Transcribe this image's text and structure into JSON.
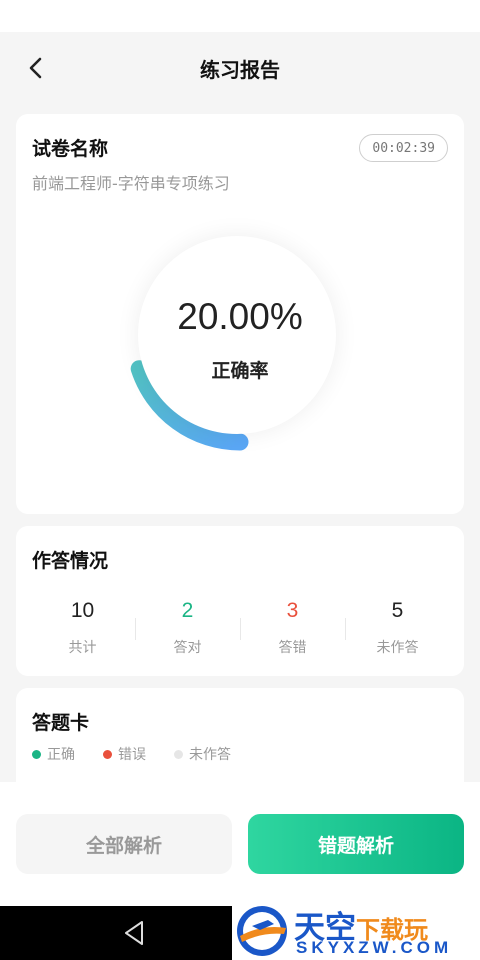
{
  "header": {
    "title": "练习报告"
  },
  "summary": {
    "paper_label": "试卷名称",
    "timer": "00:02:39",
    "paper_name": "前端工程师-字符串专项练习",
    "accuracy_text": "20.00%",
    "accuracy_label": "正确率",
    "accuracy_fraction": 0.2,
    "gauge_colors": [
      "#5aa7f5",
      "#52c2c5"
    ]
  },
  "answers": {
    "title": "作答情况",
    "stats": [
      {
        "value": "10",
        "label": "共计",
        "color": "#222222"
      },
      {
        "value": "2",
        "label": "答对",
        "color": "#1bb585"
      },
      {
        "value": "3",
        "label": "答错",
        "color": "#e9503c"
      },
      {
        "value": "5",
        "label": "未作答",
        "color": "#222222"
      }
    ]
  },
  "answer_sheet": {
    "title": "答题卡",
    "legend": [
      {
        "label": "正确",
        "color": "#1bb585"
      },
      {
        "label": "错误",
        "color": "#e9503c"
      },
      {
        "label": "未作答",
        "color": "#e6e6e6"
      }
    ]
  },
  "actions": {
    "all_analysis": "全部解析",
    "wrong_analysis": "错题解析"
  },
  "watermark": {
    "title_main": "天空",
    "title_tail": "下载玩",
    "subtitle": "SKYXZW.COM"
  },
  "icons": {
    "back": "chevron-left-icon",
    "system_back": "triangle-back-icon",
    "logo": "skyxzw-logo"
  }
}
